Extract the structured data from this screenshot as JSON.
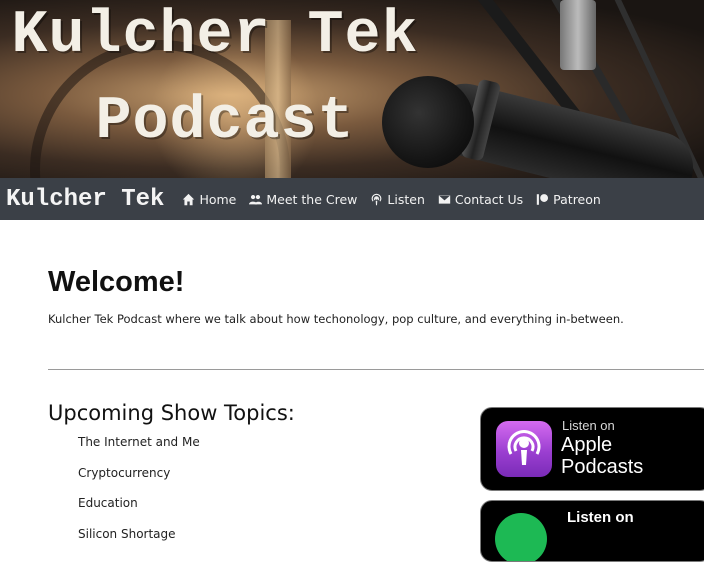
{
  "hero": {
    "title_line1": "Kulcher Tek",
    "title_line2": "Podcast"
  },
  "nav": {
    "brand": "Kulcher Tek",
    "items": [
      {
        "label": "Home",
        "icon": "home-icon"
      },
      {
        "label": "Meet the Crew",
        "icon": "users-icon"
      },
      {
        "label": "Listen",
        "icon": "podcast-icon"
      },
      {
        "label": "Contact Us",
        "icon": "envelope-icon"
      },
      {
        "label": "Patreon",
        "icon": "patreon-icon"
      }
    ]
  },
  "main": {
    "heading": "Welcome!",
    "tagline": "Kulcher Tek Podcast where we talk about how techonology, pop culture, and everything in-between.",
    "upcoming_heading": "Upcoming Show Topics:",
    "topics": [
      "The Internet and Me",
      "Cryptocurrency",
      "Education",
      "Silicon Shortage"
    ]
  },
  "badges": {
    "apple": {
      "listen": "Listen on",
      "brand_line1": "Apple",
      "brand_line2": "Podcasts"
    },
    "spotify": {
      "listen": "Listen on"
    }
  },
  "colors": {
    "nav_bg": "#3b4047",
    "apple_purple": "#9b3fd1",
    "spotify_green": "#1db954"
  }
}
